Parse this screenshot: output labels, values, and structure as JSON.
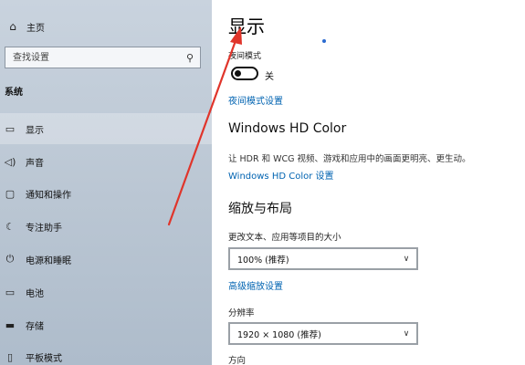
{
  "sidebar": {
    "home_label": "主页",
    "search_placeholder": "查找设置",
    "section_heading": "系统",
    "items": [
      {
        "label": "显示",
        "icon": "monitor-icon"
      },
      {
        "label": "声音",
        "icon": "speaker-icon"
      },
      {
        "label": "通知和操作",
        "icon": "notification-icon"
      },
      {
        "label": "专注助手",
        "icon": "moon-icon"
      },
      {
        "label": "电源和睡眠",
        "icon": "power-icon"
      },
      {
        "label": "电池",
        "icon": "battery-icon"
      },
      {
        "label": "存储",
        "icon": "storage-icon"
      },
      {
        "label": "平板模式",
        "icon": "tablet-icon"
      }
    ]
  },
  "main": {
    "title": "显示",
    "night_light": {
      "label": "夜间模式",
      "state_label": "关",
      "settings_link": "夜间模式设置"
    },
    "hd_color": {
      "title": "Windows HD Color",
      "description": "让 HDR 和 WCG 视频、游戏和应用中的画面更明亮、更生动。",
      "settings_link": "Windows HD Color 设置"
    },
    "scale_layout": {
      "title": "缩放与布局",
      "text_size_label": "更改文本、应用等项目的大小",
      "text_size_value": "100% (推荐)",
      "advanced_link": "高级缩放设置",
      "resolution_label": "分辨率",
      "resolution_value": "1920 × 1080 (推荐)",
      "orientation_label": "方向"
    }
  },
  "colors": {
    "link": "#0063b1",
    "annotation_arrow": "#e0352b"
  }
}
